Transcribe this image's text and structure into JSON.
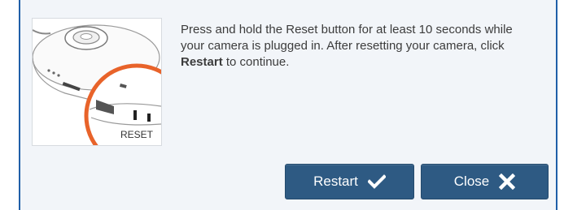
{
  "dialog": {
    "message_part1": "Press and hold the Reset button for at least 10 seconds while your camera is plugged in. After resetting your camera, click ",
    "message_bold": "Restart",
    "message_part2": " to continue.",
    "illustration": {
      "label": "RESET"
    },
    "buttons": {
      "restart_label": "Restart",
      "restart_icon": "checkmark-icon",
      "close_label": "Close",
      "close_icon": "x-close-icon"
    }
  },
  "colors": {
    "button_bg": "#2e5a83",
    "accent_orange": "#e8632a",
    "dialog_bg": "#f2f5f9",
    "border_blue": "#1f5fa8"
  }
}
